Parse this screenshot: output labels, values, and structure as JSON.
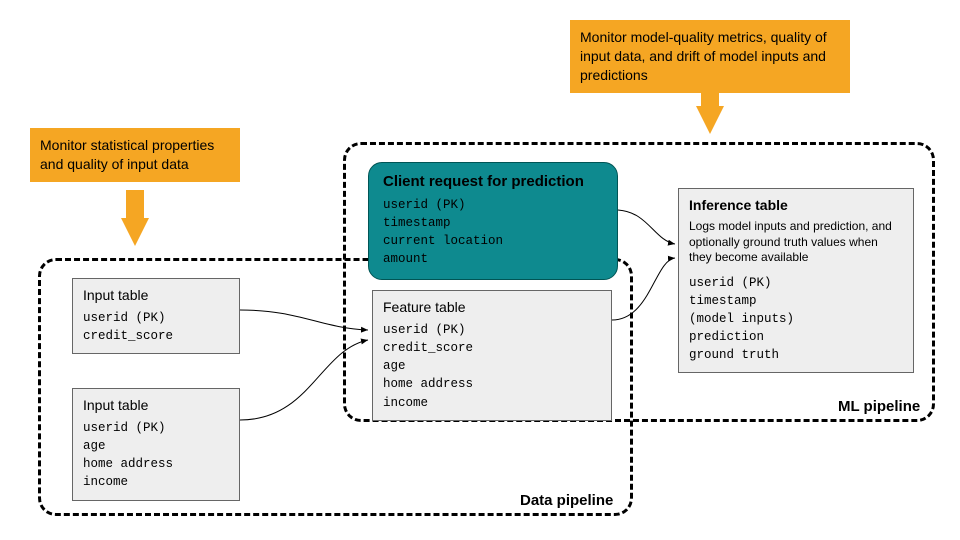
{
  "callouts": {
    "left": "Monitor statistical properties and quality of input data",
    "right": "Monitor model-quality metrics, quality of input data, and drift of model inputs and predictions"
  },
  "pipelines": {
    "data": "Data pipeline",
    "ml": "ML pipeline"
  },
  "tables": {
    "input1": {
      "title": "Input table",
      "fields": "userid (PK)\ncredit_score"
    },
    "input2": {
      "title": "Input table",
      "fields": "userid (PK)\nage\nhome address\nincome"
    },
    "feature": {
      "title": "Feature table",
      "fields": "userid (PK)\ncredit_score\nage\nhome address\nincome"
    },
    "client": {
      "title": "Client request for prediction",
      "fields": "userid (PK)\ntimestamp\ncurrent location\namount"
    },
    "inference": {
      "title": "Inference table",
      "desc": "Logs model inputs and prediction, and optionally ground truth values when they become available",
      "fields": "userid (PK)\ntimestamp\n(model inputs)\nprediction\nground truth"
    }
  }
}
